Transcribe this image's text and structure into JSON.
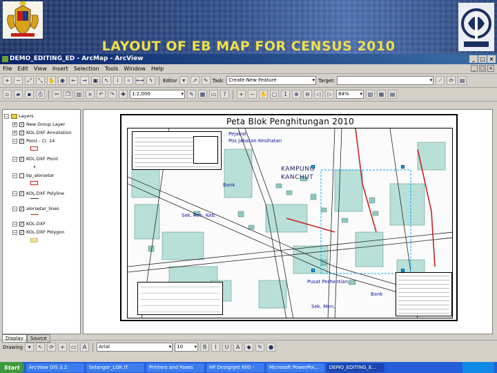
{
  "slide": {
    "title": "LAYOUT OF EB MAP FOR CENSUS 2010"
  },
  "window": {
    "title": "DEMO_EDITING_ED - ArcMap - ArcView",
    "controls": [
      "_",
      "□",
      "×"
    ]
  },
  "menu": {
    "items": [
      "File",
      "Edit",
      "View",
      "Insert",
      "Selection",
      "Tools",
      "Window",
      "Help"
    ]
  },
  "toolbar": {
    "editor_label": "Editor",
    "task_label": "Task:",
    "task_value": "Create New Feature",
    "target_label": "Target:",
    "scale_value": "1:2,000",
    "zoom_value": "84%"
  },
  "toc": {
    "root": "Layers",
    "layers": [
      {
        "name": "New Group Layer",
        "checked": true
      },
      {
        "name": "KOL.DXF Annotation",
        "checked": true
      },
      {
        "name": "Point - Cl. 14",
        "checked": true
      },
      {
        "name": "KOL.DXF Point",
        "checked": true
      },
      {
        "name": "bp_alorsetar",
        "checked": false
      },
      {
        "name": "KOL.DXF Polyline",
        "checked": true
      },
      {
        "name": "alorsetar_lines",
        "checked": true
      },
      {
        "name": "KOL.DXF",
        "checked": true
      },
      {
        "name": "KOL.DXF Polygon",
        "checked": true
      }
    ],
    "tabs": [
      "Display",
      "Source"
    ]
  },
  "map": {
    "page_title": "Peta Blok Penghitungan 2010",
    "places": [
      "Pejabat",
      "Pos Jabatan Kesihatan",
      "KAMPUNG",
      "KANCHUT",
      "Bank",
      "Sek. Ren. Keb.",
      "Pusat Perhentian",
      "Bank",
      "Sek. Men."
    ],
    "fill_colors": {
      "block": "#b8e0d8",
      "road": "#ffffff",
      "road_edge": "#202020",
      "street_red": "#c82020",
      "annotation": "#1010a0"
    }
  },
  "drawbar": {
    "drawing_label": "Drawing",
    "font_value": "Arial",
    "size_value": "10"
  },
  "taskbar": {
    "start_label": "Start",
    "tasks": [
      "ArcView GIS 3.2",
      "Selangor_LGK.IT",
      "Printers and Faxes",
      "HP DesignJet 600 -",
      "Microsoft PowerPoi...",
      "DEMO_EDITING_E..."
    ]
  }
}
